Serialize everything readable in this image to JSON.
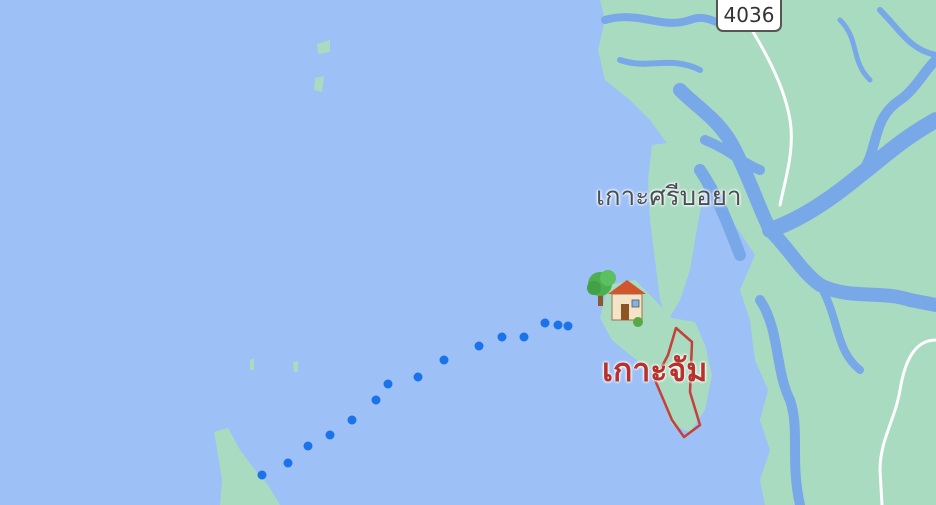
{
  "map": {
    "labels": {
      "island_north": "เกาะศรีบอยา",
      "selected_area": "เกาะจัม"
    },
    "road_shield": "4036",
    "pin": {
      "type": "home",
      "icon": "house-with-tree-icon"
    },
    "route": {
      "style": "dotted",
      "color": "#1a73e8"
    },
    "colors": {
      "water": "#9dc0f6",
      "land": "#a9dbc0",
      "river": "#79a8e8",
      "road": "#ffffff",
      "area_outline": "#c5403a",
      "area_label": "#b8322c"
    }
  }
}
